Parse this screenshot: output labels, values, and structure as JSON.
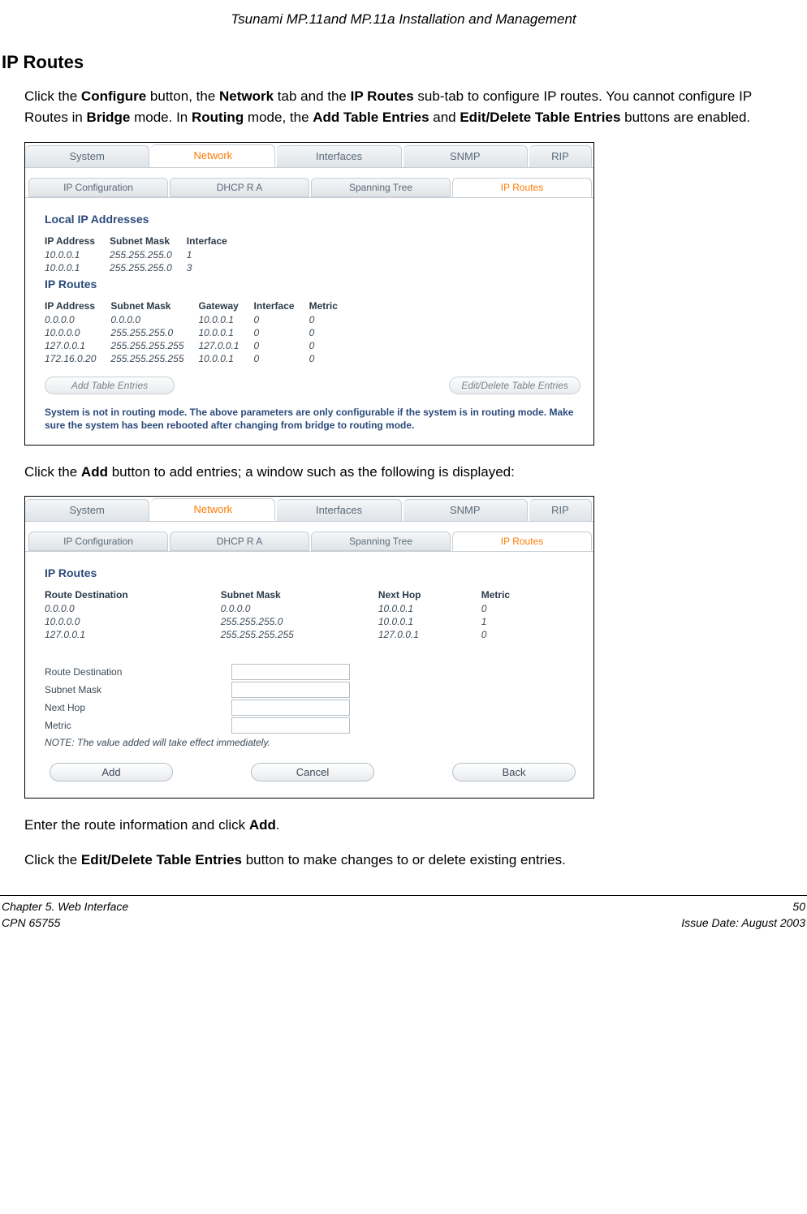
{
  "doc": {
    "header_title": "Tsunami MP.11and MP.11a Installation and Management",
    "section_title": "IP Routes",
    "para1_pre": "Click the ",
    "para1_b1": "Configure",
    "para1_mid1": " button, the ",
    "para1_b2": "Network",
    "para1_mid2": " tab and the ",
    "para1_b3": "IP Routes",
    "para1_mid3": " sub-tab to configure IP routes.  You cannot configure IP Routes in ",
    "para1_b4": "Bridge",
    "para1_mid4": " mode.  In ",
    "para1_b5": "Routing",
    "para1_mid5": " mode, the ",
    "para1_b6": "Add Table Entries",
    "para1_mid6": " and ",
    "para1_b7": "Edit/Delete Table Entries",
    "para1_end": " buttons are enabled.",
    "para2_pre": "Click the ",
    "para2_b1": "Add",
    "para2_end": " button to add entries; a window such as the following is displayed:",
    "para3_pre": "Enter the route information and click ",
    "para3_b1": "Add",
    "para3_end": ".",
    "para4_pre": "Click the ",
    "para4_b1": "Edit/Delete Table Entries",
    "para4_end": " button to make changes to or delete existing entries."
  },
  "tabs": {
    "main": [
      "System",
      "Network",
      "Interfaces",
      "SNMP",
      "RIP"
    ],
    "sub": [
      "IP Configuration",
      "DHCP R A",
      "Spanning Tree",
      "IP Routes"
    ]
  },
  "ss1": {
    "h_local": "Local IP Addresses",
    "local_cols": [
      "IP Address",
      "Subnet Mask",
      "Interface"
    ],
    "local_rows": [
      [
        "10.0.0.1",
        "255.255.255.0",
        "1"
      ],
      [
        "10.0.0.1",
        "255.255.255.0",
        "3"
      ]
    ],
    "h_routes": "IP Routes",
    "route_cols": [
      "IP Address",
      "Subnet Mask",
      "Gateway",
      "Interface",
      "Metric"
    ],
    "route_rows": [
      [
        "0.0.0.0",
        "0.0.0.0",
        "10.0.0.1",
        "0",
        "0"
      ],
      [
        "10.0.0.0",
        "255.255.255.0",
        "10.0.0.1",
        "0",
        "0"
      ],
      [
        "127.0.0.1",
        "255.255.255.255",
        "127.0.0.1",
        "0",
        "0"
      ],
      [
        "172.16.0.20",
        "255.255.255.255",
        "10.0.0.1",
        "0",
        "0"
      ]
    ],
    "btn_add": "Add Table Entries",
    "btn_edit": "Edit/Delete Table Entries",
    "warning": "System is not in routing mode. The above parameters are only configurable if the system is in routing mode. Make sure the system has been rebooted after changing from bridge to routing mode."
  },
  "ss2": {
    "h_routes": "IP Routes",
    "cols": [
      "Route Destination",
      "Subnet Mask",
      "Next Hop",
      "Metric"
    ],
    "rows": [
      [
        "0.0.0.0",
        "0.0.0.0",
        "10.0.0.1",
        "0"
      ],
      [
        "10.0.0.0",
        "255.255.255.0",
        "10.0.0.1",
        "1"
      ],
      [
        "127.0.0.1",
        "255.255.255.255",
        "127.0.0.1",
        "0"
      ]
    ],
    "fields": [
      "Route Destination",
      "Subnet Mask",
      "Next Hop",
      "Metric"
    ],
    "note": "NOTE: The value added will take effect immediately.",
    "btn_add": "Add",
    "btn_cancel": "Cancel",
    "btn_back": "Back"
  },
  "footer": {
    "left1": "Chapter 5.  Web Interface",
    "left2": "CPN 65755",
    "right1": "50",
    "right2": "Issue Date:  August 2003"
  }
}
